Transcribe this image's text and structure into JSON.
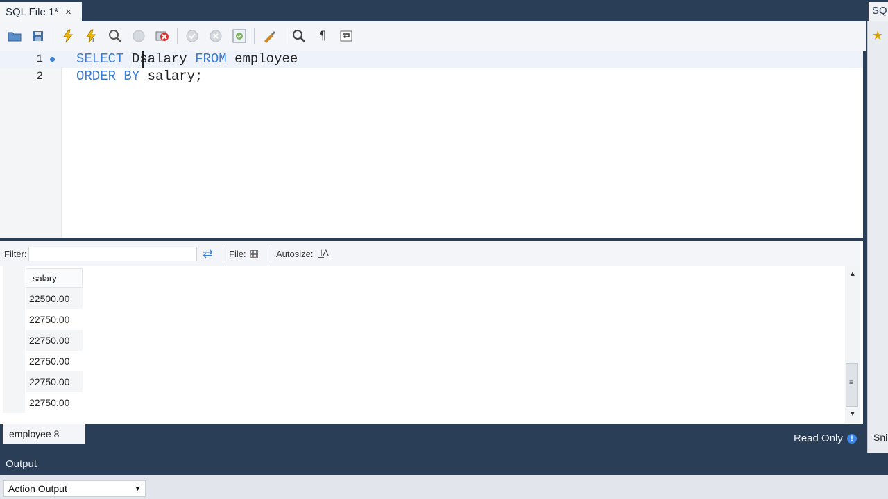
{
  "tabs": {
    "active_label": "SQL File 1*",
    "close_glyph": "×",
    "right_tab_label": "SQ"
  },
  "toolbar": {
    "buttons": [
      "open-folder-icon",
      "save-icon",
      "execute-icon",
      "execute-current-icon",
      "explain-icon",
      "stop-icon",
      "toggle-error-icon",
      "commit-icon",
      "rollback-icon",
      "autocommit-icon",
      "beautify-icon",
      "find-icon",
      "invisible-chars-icon",
      "wrap-lines-icon"
    ]
  },
  "editor": {
    "lines": [
      {
        "num": "1",
        "kw1": "SELECT",
        "mid": " D",
        "rest": "salary ",
        "kw2": "FROM",
        "tail": " employee"
      },
      {
        "num": "2",
        "kw1": "ORDER BY",
        "mid": "",
        "rest": " salary;",
        "kw2": "",
        "tail": ""
      }
    ]
  },
  "results": {
    "filter_label": "Filter:",
    "filter_value": "",
    "file_label": "File:",
    "autosize_label": "Autosize:",
    "column_header": "salary",
    "rows": [
      "22500.00",
      "22750.00",
      "22750.00",
      "22750.00",
      "22750.00",
      "22750.00"
    ],
    "result_tab": "employee 8",
    "read_only_label": "Read Only",
    "info_glyph": "!"
  },
  "output": {
    "title": "Output",
    "selected": "Action Output"
  },
  "right_panel": {
    "snippet_label": "Sni"
  },
  "colors": {
    "chrome": "#2b3e57",
    "keyword": "#3a7bd5",
    "accent": "#3d86e8"
  }
}
